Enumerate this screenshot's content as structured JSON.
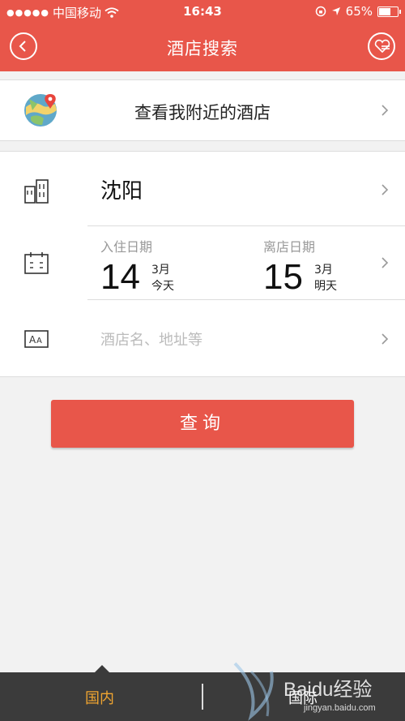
{
  "status_bar": {
    "carrier": "中国移动",
    "time": "16:43",
    "battery_percent": "65%",
    "battery_level": 0.65
  },
  "nav": {
    "title": "酒店搜索",
    "back_icon": "chevron-left-icon",
    "fav_icon": "heart-list-icon"
  },
  "nearby": {
    "label": "查看我附近的酒店",
    "icon": "map-pin-icon"
  },
  "search_form": {
    "city": "沈阳",
    "check_in": {
      "label": "入住日期",
      "day": "14",
      "month": "3月",
      "relative": "今天"
    },
    "check_out": {
      "label": "离店日期",
      "day": "15",
      "month": "3月",
      "relative": "明天"
    },
    "keyword_placeholder": "酒店名、地址等"
  },
  "search_button": {
    "label": "查询"
  },
  "tabs": [
    {
      "label": "国内",
      "active": true
    },
    {
      "label": "国际",
      "active": false
    }
  ],
  "watermark": {
    "text": "Baidu经验",
    "url_text": "jingyan.baidu.com"
  },
  "colors": {
    "brand": "#e8564a",
    "active_tab": "#f0a530",
    "tabbar_bg": "#3b3b3b"
  }
}
